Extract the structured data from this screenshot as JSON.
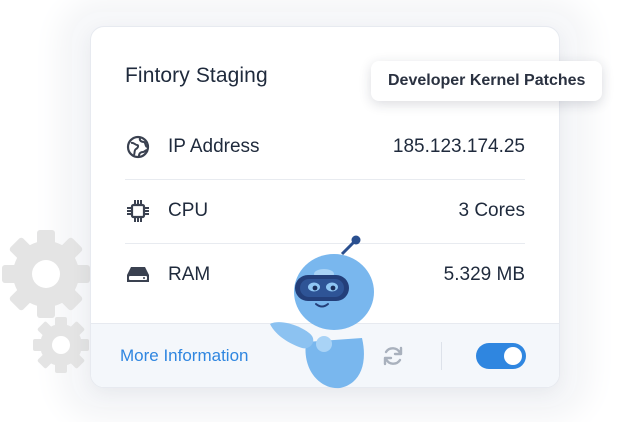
{
  "card": {
    "title": "Fintory Staging",
    "rows": [
      {
        "label": "IP Address",
        "value": "185.123.174.25",
        "icon": "globe-icon"
      },
      {
        "label": "CPU",
        "value": "3 Cores",
        "icon": "cpu-chip-icon"
      },
      {
        "label": "RAM",
        "value": "5.329 MB",
        "icon": "drive-icon"
      }
    ],
    "footer": {
      "more_label": "More Information",
      "refresh_icon": "refresh-icon",
      "toggle_on": true
    }
  },
  "tooltip": {
    "text": "Developer Kernel Patches"
  },
  "colors": {
    "accent": "#2f86e0",
    "text": "#1f2a3c",
    "robot_body": "#79b7ee",
    "gears": "#e3e3e3"
  }
}
